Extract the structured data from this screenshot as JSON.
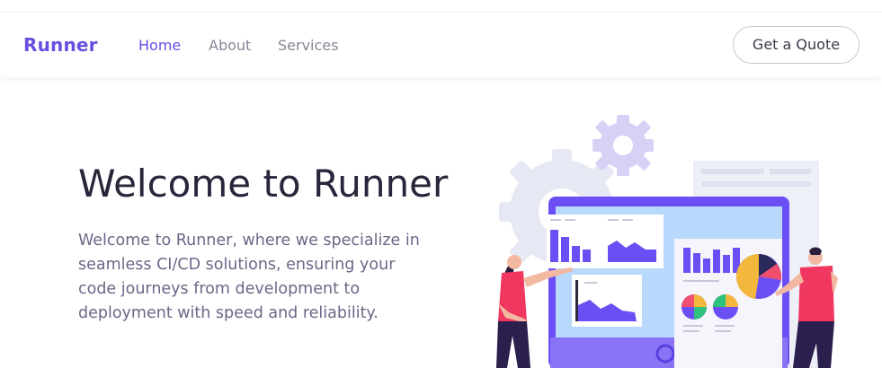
{
  "nav": {
    "brand": "Runner",
    "links": [
      {
        "label": "Home",
        "active": true
      },
      {
        "label": "About",
        "active": false
      },
      {
        "label": "Services",
        "active": false
      }
    ],
    "cta_label": "Get a Quote"
  },
  "hero": {
    "title": "Welcome to Runner",
    "description": "Welcome to Runner, where we specialize in seamless CI/CD solutions, ensuring your code journeys from development to deployment with speed and reliability."
  },
  "colors": {
    "accent": "#6a4ee0",
    "text_dark": "#27263a",
    "text_muted": "#6b6787",
    "nav_muted": "#8a8598"
  }
}
